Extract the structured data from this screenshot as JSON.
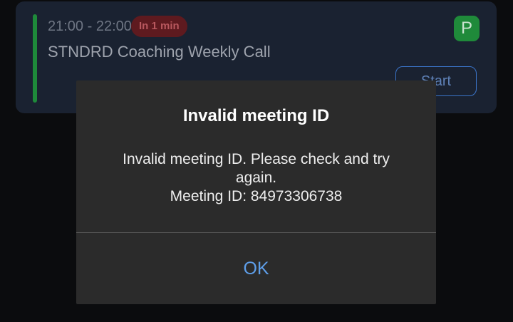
{
  "meeting_card": {
    "time_range": "21:00 - 22:00",
    "starts_in": "In 1 min",
    "title": "STNDRD Coaching Weekly Call",
    "avatar_letter": "P",
    "start_label": "Start"
  },
  "dialog": {
    "title": "Invalid meeting ID",
    "message_line1": "Invalid meeting ID. Please check and try",
    "message_line2": "again.",
    "meeting_id_line": "Meeting ID: 84973306738",
    "ok_label": "OK"
  },
  "colors": {
    "background": "#0b0c0e",
    "card_background": "#1a2231",
    "accent_green": "#1e8a3a",
    "badge_red": "#5e1a1f",
    "dialog_background": "#2b2b2b",
    "link_blue": "#5e9ee9"
  },
  "icons": {
    "avatar": "letter-avatar"
  }
}
